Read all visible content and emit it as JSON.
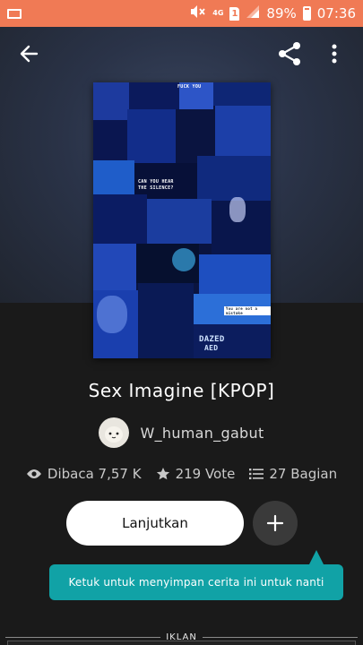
{
  "status_bar": {
    "network": "4G",
    "sim": "1",
    "battery": "89%",
    "time": "07:36"
  },
  "toolbar": {
    "back_icon": "arrow-back-icon",
    "share_icon": "share-icon",
    "menu_icon": "more-vert-icon"
  },
  "cover": {
    "caption_top": "FUCK YOU",
    "caption_mid1": "CAN YOU HEAR",
    "caption_mid2": "THE SILENCE?",
    "caption_btn": "You are not a mistake",
    "caption_bottom1": "DAZED",
    "caption_bottom2": "AED"
  },
  "story": {
    "title": "Sex Imagine [KPOP]",
    "author": "W_human_gabut"
  },
  "stats": {
    "reads": "Dibaca 7,57 K",
    "votes": "219 Vote",
    "parts": "27 Bagian"
  },
  "actions": {
    "continue_label": "Lanjutkan",
    "add_icon": "plus-icon"
  },
  "tooltip": {
    "text": "Ketuk untuk menyimpan cerita ini untuk nanti"
  },
  "ad": {
    "label": "IKLAN"
  },
  "colors": {
    "status_bar": "#f07a55",
    "accent": "#11a2a6",
    "background": "#1a1a1a"
  }
}
